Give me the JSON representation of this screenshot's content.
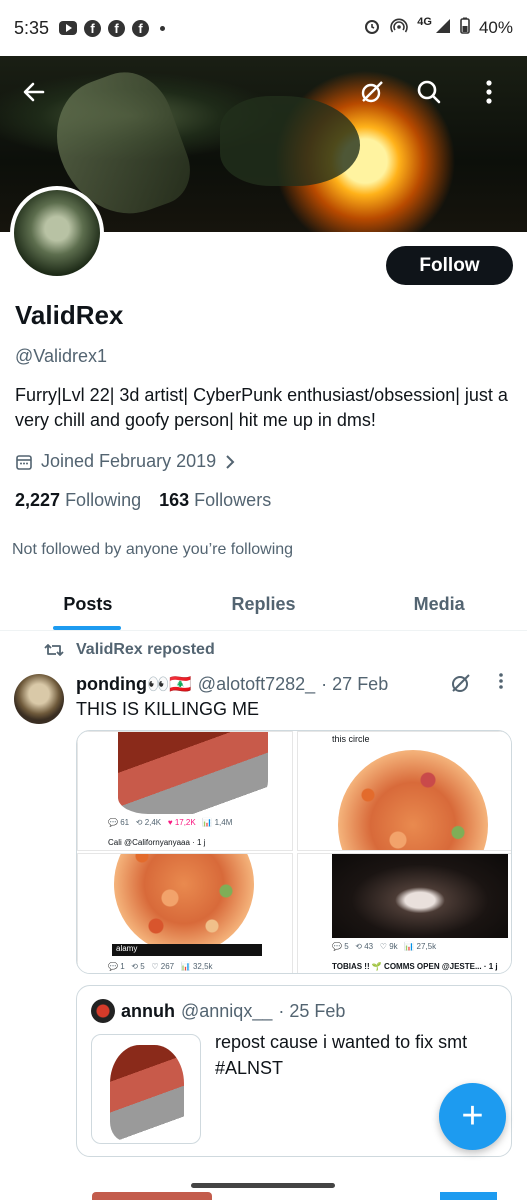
{
  "status_bar": {
    "time": "5:35",
    "network": "4G",
    "battery": "40%"
  },
  "profile": {
    "name": "ValidRex",
    "handle": "@Validrex1",
    "bio": "Furry|Lvl 22| 3d artist| CyberPunk enthusiast/obsession| just a very chill and goofy person| hit me up in dms!",
    "joined": "Joined February 2019",
    "following_count": "2,227",
    "following_label": "Following",
    "followers_count": "163",
    "followers_label": "Followers",
    "not_followed": "Not followed by anyone you’re following",
    "follow_label": "Follow"
  },
  "tabs": [
    {
      "label": "Posts"
    },
    {
      "label": "Replies"
    },
    {
      "label": "Media"
    }
  ],
  "post": {
    "repost_label": "ValidRex reposted",
    "author_name": "ponding👀🇱🇧",
    "author_handle": "@alotoft7282_",
    "date": "· 27 Feb",
    "text": "THIS IS KILLINGG ME",
    "media": {
      "circle_caption": "this circle",
      "stats_top": [
        "61",
        "2,4K",
        "17,2K",
        "1,4M"
      ],
      "cali_handle": "Cali @Californyanyaaa · 1 j",
      "stats_right": [
        "5",
        "43",
        "9k",
        "27,5k"
      ],
      "stats_bottom": [
        "1",
        "5",
        "267",
        "32,5k"
      ],
      "alamy": "alamy",
      "tobias": "TOBIAS !! 🌱 COMMS OPEN @JESTE... · 1 j"
    },
    "quote": {
      "name": "annuh",
      "handle": "@anniqx__",
      "date": "· 25 Feb",
      "text": "repost cause i wanted to fix smt #ALNST"
    }
  },
  "fab": {
    "label": "+"
  }
}
